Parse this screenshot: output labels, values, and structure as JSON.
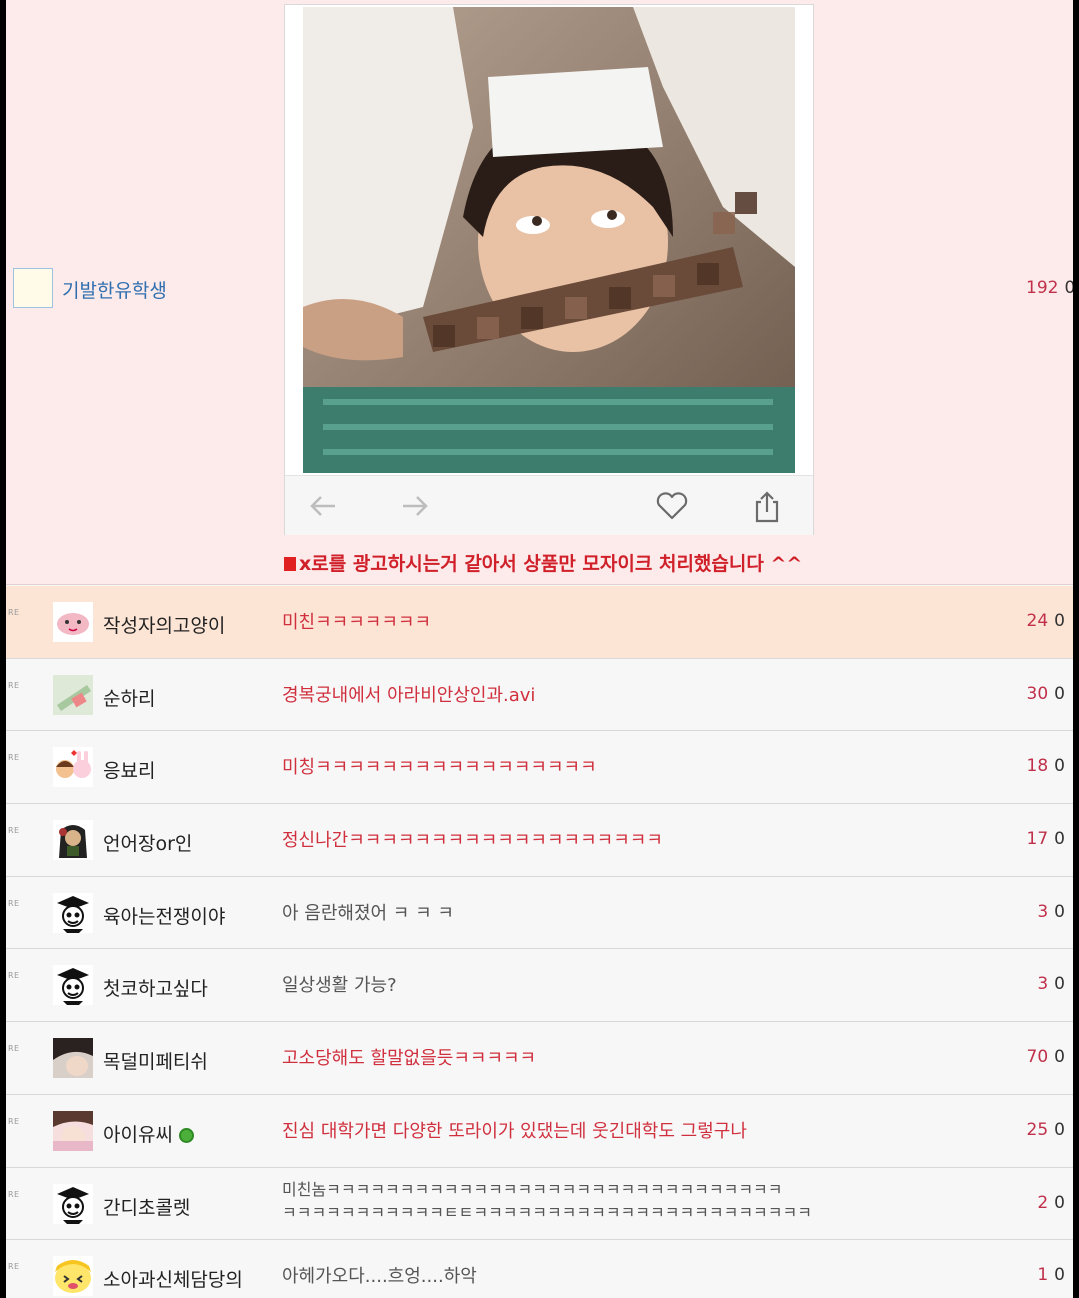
{
  "post": {
    "author": "기발한유학생",
    "count": "192",
    "count_zero": "0",
    "notice": "x로를 광고하시는거 같아서 상품만 모자이크 처리했습니다 ^^"
  },
  "comments": [
    {
      "re": "RE",
      "name": "작성자의고양이",
      "text": "미친ㅋㅋㅋㅋㅋㅋㅋ",
      "count": "24",
      "zero": "0",
      "style": "red",
      "highlight": true,
      "avatar_icon": "cat-avatar-icon"
    },
    {
      "re": "RE",
      "name": "순하리",
      "text": "경복궁내에서 아라비안상인과.avi",
      "count": "30",
      "zero": "0",
      "style": "red",
      "avatar_icon": "bottle-avatar-icon"
    },
    {
      "re": "RE",
      "name": "응뵤리",
      "text": "미칭ㅋㅋㅋㅋㅋㅋㅋㅋㅋㅋㅋㅋㅋㅋㅋㅋㅋ",
      "count": "18",
      "zero": "0",
      "style": "red",
      "avatar_icon": "couple-avatar-icon"
    },
    {
      "re": "RE",
      "name": "언어장or인",
      "text": "정신나간ㅋㅋㅋㅋㅋㅋㅋㅋㅋㅋㅋㅋㅋㅋㅋㅋㅋㅋㅋ",
      "count": "17",
      "zero": "0",
      "style": "red",
      "avatar_icon": "character-avatar-icon"
    },
    {
      "re": "RE",
      "name": "육아는전쟁이야",
      "text": "아 음란해졌어 ㅋ ㅋ ㅋ",
      "count": "3",
      "zero": "0",
      "style": "gray",
      "avatar_icon": "graduate-avatar-icon"
    },
    {
      "re": "RE",
      "name": "첫코하고싶다",
      "text": "일상생활 가능?",
      "count": "3",
      "zero": "0",
      "style": "gray",
      "avatar_icon": "graduate-avatar-icon"
    },
    {
      "re": "RE",
      "name": "목덜미페티쉬",
      "text": "고소당해도 할말없을듯ㅋㅋㅋㅋㅋ",
      "count": "70",
      "zero": "0",
      "style": "red",
      "avatar_icon": "photo-avatar-icon"
    },
    {
      "re": "RE",
      "name": "아이유씨",
      "text": "진심 대학가면 다양한 또라이가 있댔는데 웃긴대학도 그렇구나",
      "count": "25",
      "zero": "0",
      "style": "red",
      "avatar_icon": "photo-avatar-icon",
      "online_badge": true
    },
    {
      "re": "RE",
      "name": "간디초콜렛",
      "text_line1": "미친놈ㅋㅋㅋㅋㅋㅋㅋㅋㅋㅋㅋㅋㅋㅋㅋㅋㅋㅋㅋㅋㅋㅋㅋㅋㅋㅋㅋㅋㅋㅋㅋ",
      "text_line2": "ㅋㅋㅋㅋㅋㅋㅋㅋㅋㅋㅋㅌㅌㅋㅋㅋㅋㅋㅋㅋㅋㅋㅋㅋㅋㅋㅋㅋㅋㅋㅋㅋㅋㅋㅋㅋ",
      "count": "2",
      "zero": "0",
      "style": "gray",
      "avatar_icon": "graduate-avatar-icon"
    },
    {
      "re": "RE",
      "name": "소아과신체담당의",
      "text": "아헤가오다....흐엉....하악",
      "count": "1",
      "zero": "0",
      "style": "gray",
      "avatar_icon": "smiley-avatar-icon"
    }
  ]
}
